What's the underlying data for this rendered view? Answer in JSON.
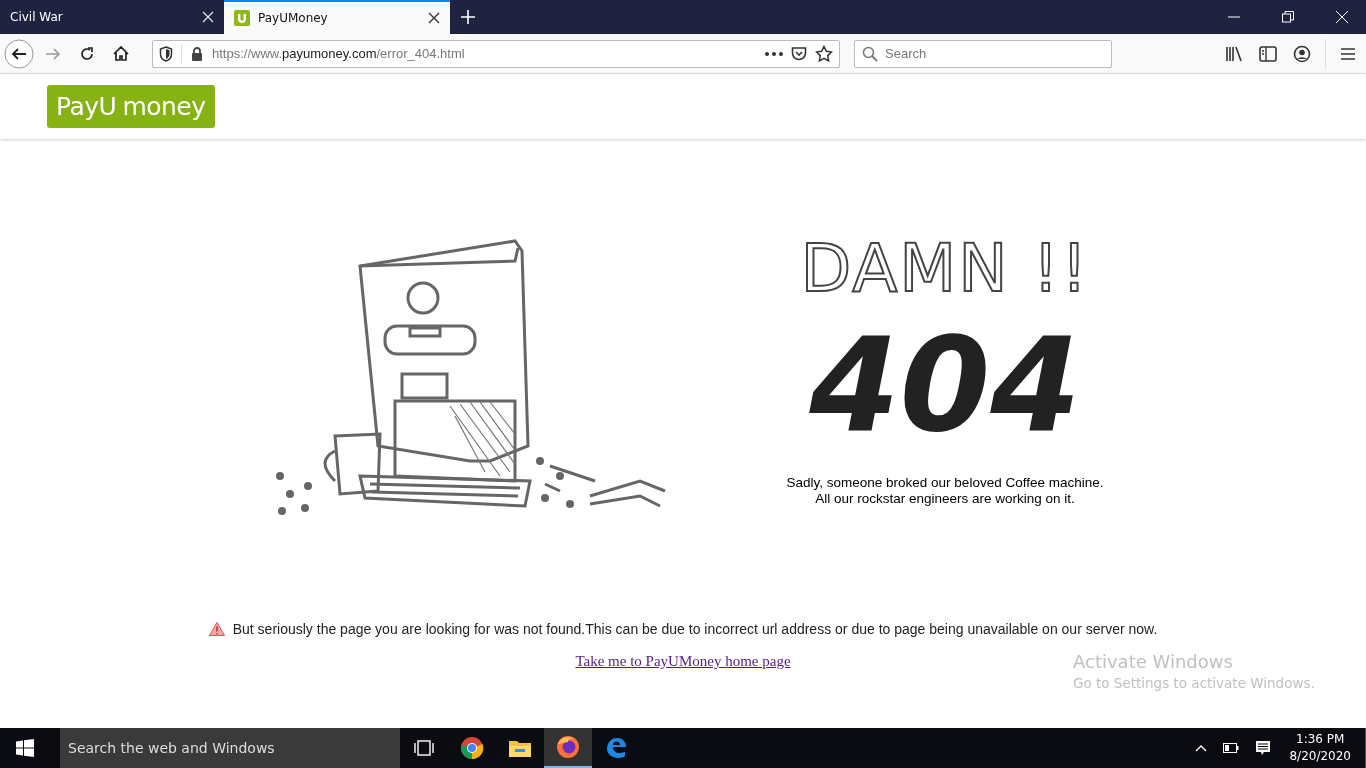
{
  "tabs": [
    {
      "title": "Civil War",
      "selected": false
    },
    {
      "title": "PayUMoney",
      "selected": true
    }
  ],
  "address_bar": {
    "scheme": "https://www.",
    "domain": "payumoney.com",
    "path": "/error_404.html"
  },
  "search": {
    "placeholder": "Search"
  },
  "logo": {
    "part_1": "PayU",
    "part_2": "money"
  },
  "error": {
    "heading": "DAMN !!",
    "code": "404",
    "caption_1": "Sadly, someone broked our beloved Coffee machine.",
    "caption_2": "All our rockstar engineers are working on it.",
    "message": "But seriously the page you are looking for was not found.This can be due to incorrect url address or due to page being unavailable on our server now.",
    "link": "Take me to PayUMoney home page"
  },
  "activation": {
    "title": "Activate Windows",
    "subtitle": "Go to Settings to activate Windows."
  },
  "taskbar": {
    "search_placeholder": "Search the web and Windows",
    "apps": [
      {
        "kind": "taskview",
        "selected": false
      },
      {
        "kind": "chrome",
        "selected": false
      },
      {
        "kind": "explorer",
        "selected": false
      },
      {
        "kind": "firefox",
        "selected": true
      },
      {
        "kind": "edge",
        "selected": false
      }
    ],
    "time": "1:36 PM",
    "date": "8/20/2020"
  }
}
